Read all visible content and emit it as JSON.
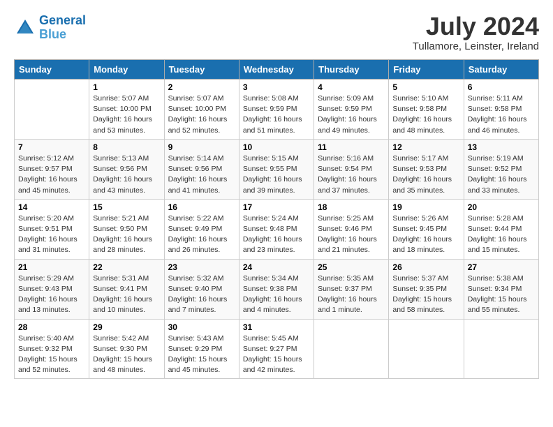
{
  "header": {
    "logo_line1": "General",
    "logo_line2": "Blue",
    "month_year": "July 2024",
    "location": "Tullamore, Leinster, Ireland"
  },
  "days_of_week": [
    "Sunday",
    "Monday",
    "Tuesday",
    "Wednesday",
    "Thursday",
    "Friday",
    "Saturday"
  ],
  "weeks": [
    [
      {
        "num": "",
        "detail": ""
      },
      {
        "num": "1",
        "detail": "Sunrise: 5:07 AM\nSunset: 10:00 PM\nDaylight: 16 hours\nand 53 minutes."
      },
      {
        "num": "2",
        "detail": "Sunrise: 5:07 AM\nSunset: 10:00 PM\nDaylight: 16 hours\nand 52 minutes."
      },
      {
        "num": "3",
        "detail": "Sunrise: 5:08 AM\nSunset: 9:59 PM\nDaylight: 16 hours\nand 51 minutes."
      },
      {
        "num": "4",
        "detail": "Sunrise: 5:09 AM\nSunset: 9:59 PM\nDaylight: 16 hours\nand 49 minutes."
      },
      {
        "num": "5",
        "detail": "Sunrise: 5:10 AM\nSunset: 9:58 PM\nDaylight: 16 hours\nand 48 minutes."
      },
      {
        "num": "6",
        "detail": "Sunrise: 5:11 AM\nSunset: 9:58 PM\nDaylight: 16 hours\nand 46 minutes."
      }
    ],
    [
      {
        "num": "7",
        "detail": "Sunrise: 5:12 AM\nSunset: 9:57 PM\nDaylight: 16 hours\nand 45 minutes."
      },
      {
        "num": "8",
        "detail": "Sunrise: 5:13 AM\nSunset: 9:56 PM\nDaylight: 16 hours\nand 43 minutes."
      },
      {
        "num": "9",
        "detail": "Sunrise: 5:14 AM\nSunset: 9:56 PM\nDaylight: 16 hours\nand 41 minutes."
      },
      {
        "num": "10",
        "detail": "Sunrise: 5:15 AM\nSunset: 9:55 PM\nDaylight: 16 hours\nand 39 minutes."
      },
      {
        "num": "11",
        "detail": "Sunrise: 5:16 AM\nSunset: 9:54 PM\nDaylight: 16 hours\nand 37 minutes."
      },
      {
        "num": "12",
        "detail": "Sunrise: 5:17 AM\nSunset: 9:53 PM\nDaylight: 16 hours\nand 35 minutes."
      },
      {
        "num": "13",
        "detail": "Sunrise: 5:19 AM\nSunset: 9:52 PM\nDaylight: 16 hours\nand 33 minutes."
      }
    ],
    [
      {
        "num": "14",
        "detail": "Sunrise: 5:20 AM\nSunset: 9:51 PM\nDaylight: 16 hours\nand 31 minutes."
      },
      {
        "num": "15",
        "detail": "Sunrise: 5:21 AM\nSunset: 9:50 PM\nDaylight: 16 hours\nand 28 minutes."
      },
      {
        "num": "16",
        "detail": "Sunrise: 5:22 AM\nSunset: 9:49 PM\nDaylight: 16 hours\nand 26 minutes."
      },
      {
        "num": "17",
        "detail": "Sunrise: 5:24 AM\nSunset: 9:48 PM\nDaylight: 16 hours\nand 23 minutes."
      },
      {
        "num": "18",
        "detail": "Sunrise: 5:25 AM\nSunset: 9:46 PM\nDaylight: 16 hours\nand 21 minutes."
      },
      {
        "num": "19",
        "detail": "Sunrise: 5:26 AM\nSunset: 9:45 PM\nDaylight: 16 hours\nand 18 minutes."
      },
      {
        "num": "20",
        "detail": "Sunrise: 5:28 AM\nSunset: 9:44 PM\nDaylight: 16 hours\nand 15 minutes."
      }
    ],
    [
      {
        "num": "21",
        "detail": "Sunrise: 5:29 AM\nSunset: 9:43 PM\nDaylight: 16 hours\nand 13 minutes."
      },
      {
        "num": "22",
        "detail": "Sunrise: 5:31 AM\nSunset: 9:41 PM\nDaylight: 16 hours\nand 10 minutes."
      },
      {
        "num": "23",
        "detail": "Sunrise: 5:32 AM\nSunset: 9:40 PM\nDaylight: 16 hours\nand 7 minutes."
      },
      {
        "num": "24",
        "detail": "Sunrise: 5:34 AM\nSunset: 9:38 PM\nDaylight: 16 hours\nand 4 minutes."
      },
      {
        "num": "25",
        "detail": "Sunrise: 5:35 AM\nSunset: 9:37 PM\nDaylight: 16 hours\nand 1 minute."
      },
      {
        "num": "26",
        "detail": "Sunrise: 5:37 AM\nSunset: 9:35 PM\nDaylight: 15 hours\nand 58 minutes."
      },
      {
        "num": "27",
        "detail": "Sunrise: 5:38 AM\nSunset: 9:34 PM\nDaylight: 15 hours\nand 55 minutes."
      }
    ],
    [
      {
        "num": "28",
        "detail": "Sunrise: 5:40 AM\nSunset: 9:32 PM\nDaylight: 15 hours\nand 52 minutes."
      },
      {
        "num": "29",
        "detail": "Sunrise: 5:42 AM\nSunset: 9:30 PM\nDaylight: 15 hours\nand 48 minutes."
      },
      {
        "num": "30",
        "detail": "Sunrise: 5:43 AM\nSunset: 9:29 PM\nDaylight: 15 hours\nand 45 minutes."
      },
      {
        "num": "31",
        "detail": "Sunrise: 5:45 AM\nSunset: 9:27 PM\nDaylight: 15 hours\nand 42 minutes."
      },
      {
        "num": "",
        "detail": ""
      },
      {
        "num": "",
        "detail": ""
      },
      {
        "num": "",
        "detail": ""
      }
    ]
  ]
}
